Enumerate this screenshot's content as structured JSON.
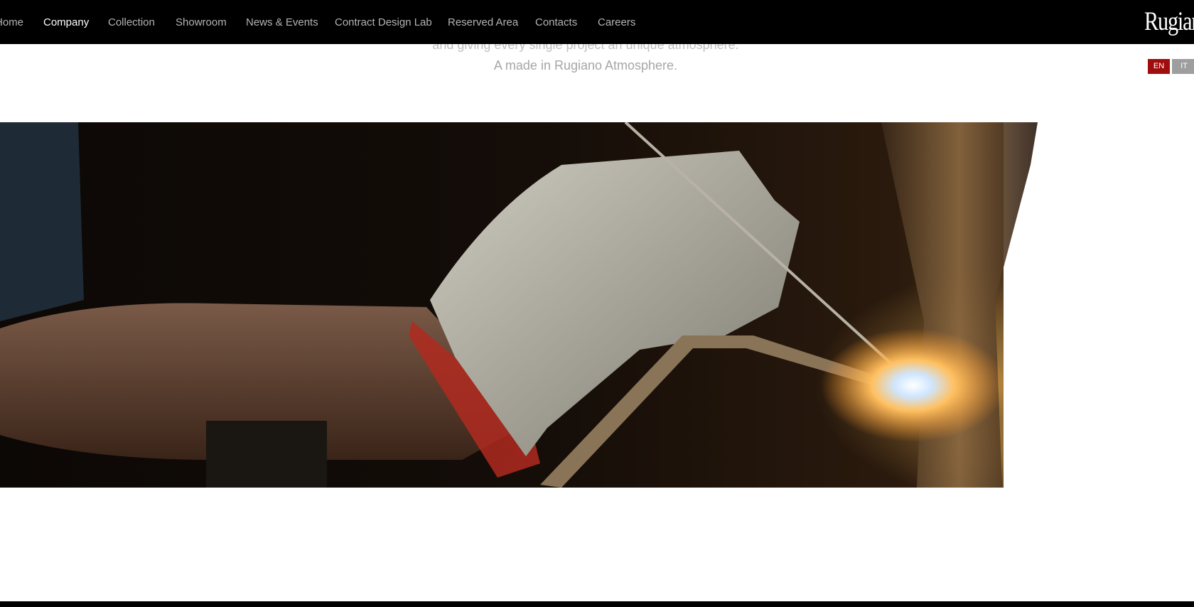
{
  "nav": {
    "items": [
      {
        "label": "Home",
        "active": false
      },
      {
        "label": "Company",
        "active": true
      },
      {
        "label": "Collection",
        "active": false
      },
      {
        "label": "Showroom",
        "active": false
      },
      {
        "label": "News & Events",
        "active": false
      },
      {
        "label": "Contract Design Lab",
        "active": false
      },
      {
        "label": "Reserved Area",
        "active": false
      },
      {
        "label": "Contacts",
        "active": false
      },
      {
        "label": "Careers",
        "active": false
      }
    ],
    "logo": "Rugiano"
  },
  "intro": {
    "line1": "and giving every single project an unique atmosphere.",
    "line2": "A made in Rugiano Atmosphere."
  },
  "language": {
    "en": "EN",
    "it": "IT",
    "selected": "EN"
  },
  "hero": {
    "image": "welding-craftsman-photo"
  },
  "colors": {
    "navbar_bg": "#000000",
    "nav_text": "#b4b4b4",
    "nav_active": "#ffffff",
    "lang_active_bg": "#a00d0d",
    "lang_inactive_bg": "#9e9e9e",
    "intro_text": "#a6a6a6"
  }
}
